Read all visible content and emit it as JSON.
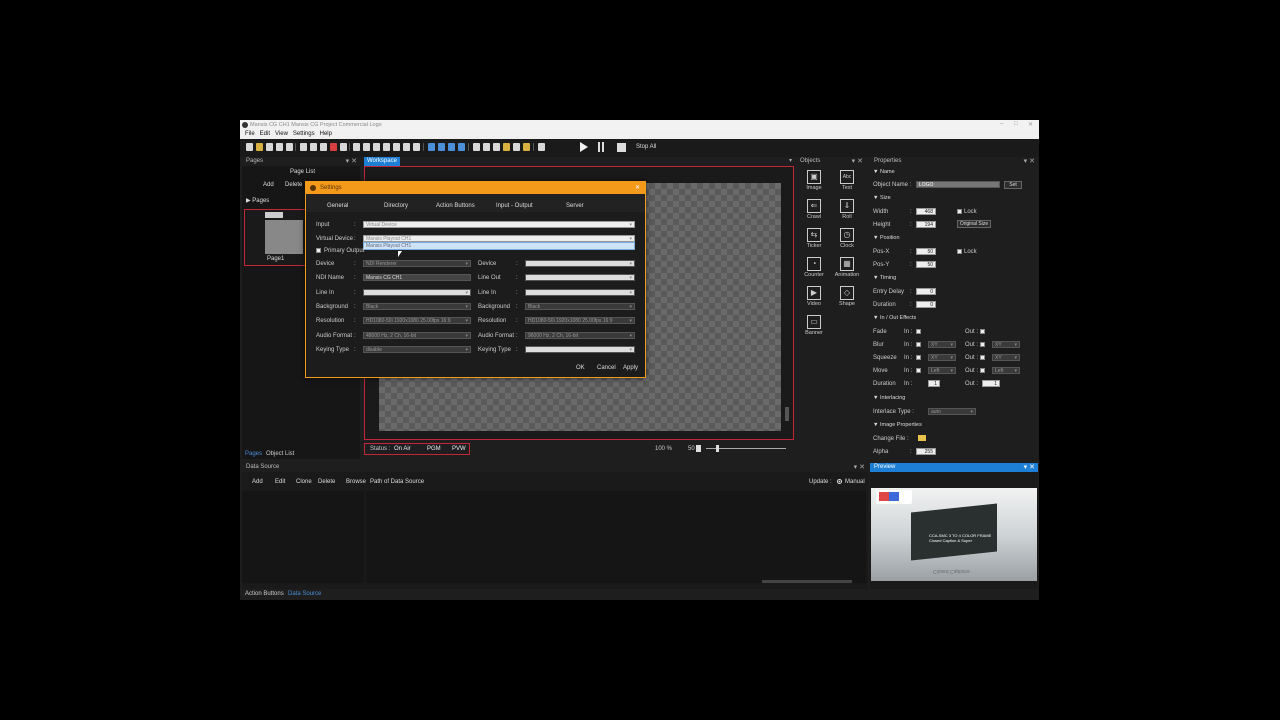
{
  "window": {
    "title": "Mansis CG CH1 Mansis CG Project Commercial Logo"
  },
  "menu": [
    "File",
    "Edit",
    "View",
    "Settings",
    "Help"
  ],
  "toolbar": {
    "stop_all_label": "Stop All"
  },
  "pages_panel": {
    "title": "Pages",
    "page_list_label": "Page List",
    "add_label": "Add",
    "delete_label": "Delete",
    "pages_label": "Pages",
    "page_name": "Page1",
    "bottom_tabs": [
      "Pages",
      "Object List"
    ]
  },
  "workspace": {
    "tab_label": "Workspace",
    "status_label": "Status :",
    "status_value": "On Air",
    "pgm_label": "PGM",
    "pvw_label": "PVW",
    "zoom_label": "100 %",
    "opacity_value": "50"
  },
  "settings_dialog": {
    "title": "Settings",
    "tabs": [
      "General",
      "Directory",
      "Action Buttons",
      "Input - Output",
      "Server"
    ],
    "input_label": "Input",
    "input_value": "Virtual Device",
    "virtual_device_label": "Virtual Device",
    "virtual_device_value": "Mansis Playout CH1",
    "dropdown_option": "Mansis Playout CH1",
    "primary_output_label": "Primary Output",
    "left": {
      "device_label": "Device",
      "device_value": "NDI Renderer",
      "ndi_name_label": "NDI Name",
      "ndi_name_value": "Mansis CG CH1",
      "line_in_label": "Line In",
      "line_in_value": "",
      "background_label": "Background",
      "background_value": "Black",
      "resolution_label": "Resolution",
      "resolution_value": "HD1080-50i 1920x1080 25.00fps 16:9",
      "audio_format_label": "Audio Format",
      "audio_format_value": "48000 Hz, 2 Ch, 16-bit",
      "keying_type_label": "Keying Type",
      "keying_type_value": "disable"
    },
    "right": {
      "device_label": "Device",
      "device_value": "",
      "line_out_label": "Line Out",
      "line_out_value": "",
      "line_in_label": "Line In",
      "line_in_value": "",
      "background_label": "Background",
      "background_value": "Black",
      "resolution_label": "Resolution",
      "resolution_value": "HD1080-50i 1920x1080 25.00fps 16:9",
      "audio_format_label": "Audio Format",
      "audio_format_value": "96000 Hz, 2 Ch, 16-bit",
      "keying_type_label": "Keying Type",
      "keying_type_value": ""
    },
    "ok_label": "OK",
    "cancel_label": "Cancel",
    "apply_label": "Apply"
  },
  "objects_panel": {
    "title": "Objects",
    "items": [
      {
        "label": "Image",
        "icon": "image-icon",
        "glyph": "▣"
      },
      {
        "label": "Text",
        "icon": "text-icon",
        "glyph": "Abc"
      },
      {
        "label": "Crawl",
        "icon": "crawl-icon",
        "glyph": "⇐"
      },
      {
        "label": "Roll",
        "icon": "roll-icon",
        "glyph": "⇓"
      },
      {
        "label": "Ticker",
        "icon": "ticker-icon",
        "glyph": "⇆"
      },
      {
        "label": "Clock",
        "icon": "clock-icon",
        "glyph": "◷"
      },
      {
        "label": "Counter",
        "icon": "counter-icon",
        "glyph": "◔"
      },
      {
        "label": "Animation",
        "icon": "animation-icon",
        "glyph": "▦"
      },
      {
        "label": "Video",
        "icon": "video-icon",
        "glyph": "▶"
      },
      {
        "label": "Shape",
        "icon": "shape-icon",
        "glyph": "◇"
      },
      {
        "label": "Banner",
        "icon": "banner-icon",
        "glyph": "▭"
      }
    ]
  },
  "properties": {
    "title": "Properties",
    "name_section": "Name",
    "object_name_label": "Object Name :",
    "object_name_value": "LOGO",
    "set_label": "Set",
    "size_section": "Size",
    "width_label": "Width",
    "width_value": "468",
    "height_label": "Height",
    "height_value": "194",
    "lock_label": "Lock",
    "original_size_label": "Original Size",
    "position_section": "Position",
    "pos_x_label": "Pos-X",
    "pos_x_value": "50",
    "pos_y_label": "Pos-Y",
    "pos_y_value": "50",
    "timing_section": "Timing",
    "entry_delay_label": "Entry Delay",
    "entry_delay_value": "0",
    "duration_label": "Duration",
    "duration_value": "0",
    "effects_section": "In / Out Effects",
    "fade_label": "Fade",
    "blur_label": "Blur",
    "squeeze_label": "Squeeze",
    "move_label": "Move",
    "effect_duration_label": "Duration",
    "in_label": "In :",
    "out_label": "Out :",
    "xy_value": "XY",
    "left_value": "Left",
    "in_duration_value": "1",
    "out_duration_value": "1",
    "interlacing_section": "Interlacing",
    "interlace_type_label": "Interlace Type :",
    "interlace_type_value": "auto",
    "image_props_section": "Image Properties",
    "change_file_label": "Change File :",
    "alpha_label": "Alpha",
    "alpha_value": "255"
  },
  "data_source": {
    "title": "Data Source",
    "buttons": [
      "Add",
      "Edit",
      "Clone",
      "Delete",
      "Browse"
    ],
    "path_label": "Path of Data Source",
    "update_label": "Update :",
    "manual_label": "Manual",
    "bottom_tabs": [
      "Action Buttons",
      "Data Source"
    ]
  },
  "preview": {
    "title": "Preview",
    "caption_line1": "CCA-SMC 3 TO 4 COLOR FRAME",
    "caption_line2": "Closed Caption & Super",
    "caption_line3": "Closed Captions"
  },
  "colors": {
    "accent_orange": "#f39a1b",
    "accent_blue": "#1e7fd6",
    "workspace_border": "#c0283a",
    "panel_bg": "#1e1e1e"
  }
}
